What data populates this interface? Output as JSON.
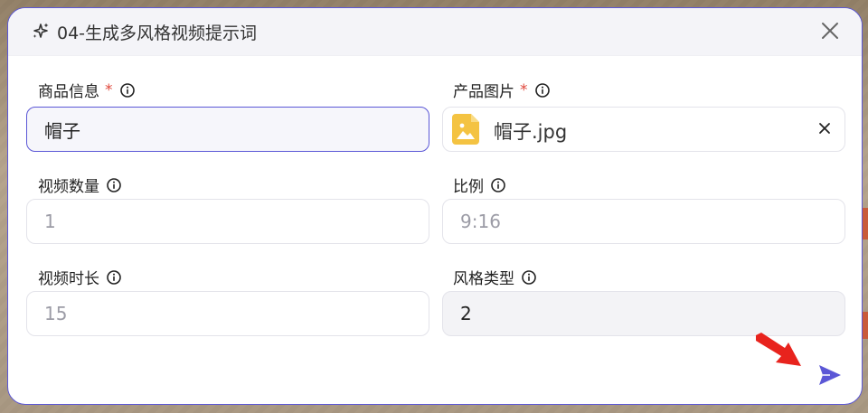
{
  "dialog": {
    "title": "04-生成多风格视频提示词",
    "icon": "sparkle-icon"
  },
  "fields": {
    "product_info": {
      "label": "商品信息",
      "required_mark": "*",
      "value": "帽子"
    },
    "product_image": {
      "label": "产品图片",
      "required_mark": "*",
      "file_name": "帽子.jpg"
    },
    "video_count": {
      "label": "视频数量",
      "placeholder": "1"
    },
    "ratio": {
      "label": "比例",
      "placeholder": "9:16"
    },
    "video_duration": {
      "label": "视频时长",
      "placeholder": "15"
    },
    "style_type": {
      "label": "风格类型",
      "value": "2"
    }
  },
  "colors": {
    "accent": "#5b57d6",
    "required": "#e0483c",
    "file_icon": "#f4c342",
    "annotation_arrow": "#e8231d"
  }
}
